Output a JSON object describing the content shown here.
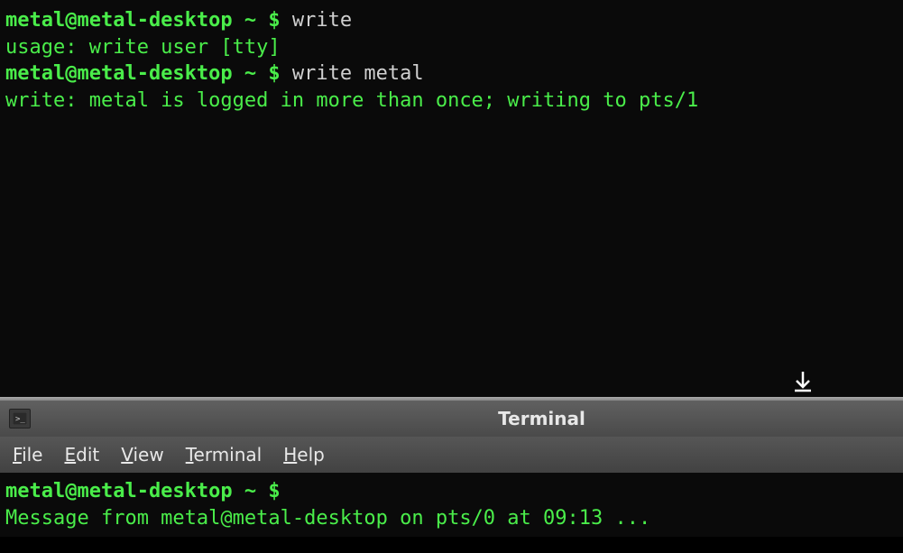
{
  "top_terminal": {
    "line1": {
      "prompt_user": "metal@metal-desktop",
      "prompt_path": " ~ ",
      "prompt_dollar": "$ ",
      "command": "write"
    },
    "line2": "usage: write user [tty]",
    "line3": {
      "prompt_user": "metal@metal-desktop",
      "prompt_path": " ~ ",
      "prompt_dollar": "$ ",
      "command": "write metal"
    },
    "line4": "write: metal is logged in more than once; writing to pts/1"
  },
  "window": {
    "title": "Terminal"
  },
  "menubar": {
    "file": "File",
    "file_u": "F",
    "file_rest": "ile",
    "edit": "Edit",
    "edit_u": "E",
    "edit_rest": "dit",
    "view": "View",
    "view_u": "V",
    "view_rest": "iew",
    "terminal": "Terminal",
    "terminal_u": "T",
    "terminal_rest": "erminal",
    "help": "Help",
    "help_u": "H",
    "help_rest": "elp"
  },
  "bottom_terminal": {
    "line1": {
      "prompt_user": "metal@metal-desktop",
      "prompt_path": " ~ ",
      "prompt_dollar": "$ "
    },
    "line2": "Message from metal@metal-desktop on pts/0 at 09:13 ..."
  }
}
